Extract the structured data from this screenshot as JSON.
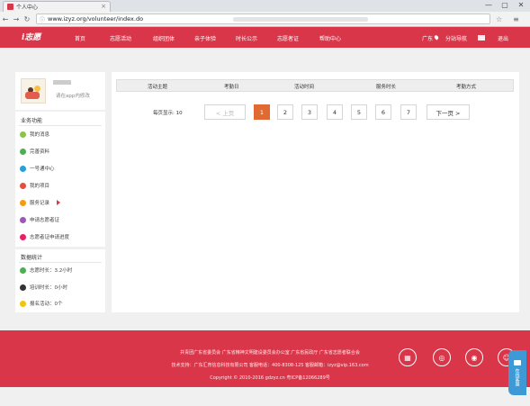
{
  "browser": {
    "tab_title": "个人中心",
    "tab_close": "×",
    "url": "www.izyz.org/volunteer/index.do",
    "window_controls": [
      "—",
      "▢",
      "✕"
    ],
    "nav": {
      "back": "←",
      "forward": "→",
      "reload": "↻"
    },
    "star": "☆",
    "menu": "≡"
  },
  "header": {
    "logo": "i志愿",
    "nav_items": [
      "首页",
      "志愿活动",
      "组织团体",
      "亲子体验",
      "时长公示",
      "志愿者证",
      "帮助中心"
    ],
    "region": "广东",
    "site_nav": "分站导航",
    "logout": "退出"
  },
  "profile": {
    "hint": "请在app内修改"
  },
  "functions": {
    "title": "业务功能",
    "items": [
      {
        "label": "我的消息",
        "icon": "message-icon",
        "color": "#8bc34a"
      },
      {
        "label": "完善资料",
        "icon": "profile-icon",
        "color": "#4caf50"
      },
      {
        "label": "一号通中心",
        "icon": "id-icon",
        "color": "#2a9fd6"
      },
      {
        "label": "我的项目",
        "icon": "project-icon",
        "color": "#e74c3c"
      },
      {
        "label": "服务记录",
        "icon": "record-icon",
        "color": "#f39c12"
      },
      {
        "label": "申请志愿者证",
        "icon": "apply-icon",
        "color": "#9b59b6"
      },
      {
        "label": "志愿者证申请进度",
        "icon": "progress-icon",
        "color": "#e91e63"
      }
    ]
  },
  "stats": {
    "title": "数据统计",
    "items": [
      {
        "label": "志愿时长：3.2小时",
        "icon": "clock-icon",
        "color": "#4caf50"
      },
      {
        "label": "培训时长：0小时",
        "icon": "training-icon",
        "color": "#333333"
      },
      {
        "label": "报名活动：0个",
        "icon": "signup-icon",
        "color": "#f1c40f"
      }
    ]
  },
  "table": {
    "columns": [
      "活动主题",
      "考勤日",
      "活动时间",
      "服务时长",
      "考勤方式"
    ]
  },
  "pager": {
    "per_page": "每页显示: 10",
    "prev": "< 上页",
    "pages": [
      "1",
      "2",
      "3",
      "4",
      "5",
      "6",
      "7"
    ],
    "current": "1",
    "next": "下一页 >"
  },
  "footer": {
    "line1": "共青团广东省委员会 广东省精神文明建设委员会办公室 广东省民政厅 广东省志愿者联合会",
    "line2": "技术支持：广东汇育信息科技有限公司 客服电话：400-8308-125 客服邮箱：izyz@vip.163.com",
    "line3": "Copyright © 2010-2016 gdzyz.cn 粤ICP备12066289号",
    "icons": [
      "shop-icon",
      "wechat-icon",
      "weibo-icon",
      "app-icon"
    ]
  },
  "float_tab": {
    "label": "在线客服"
  },
  "colors": {
    "brand": "#d9364a",
    "active_page": "#e06a32",
    "float_tab": "#3e9ad6"
  }
}
